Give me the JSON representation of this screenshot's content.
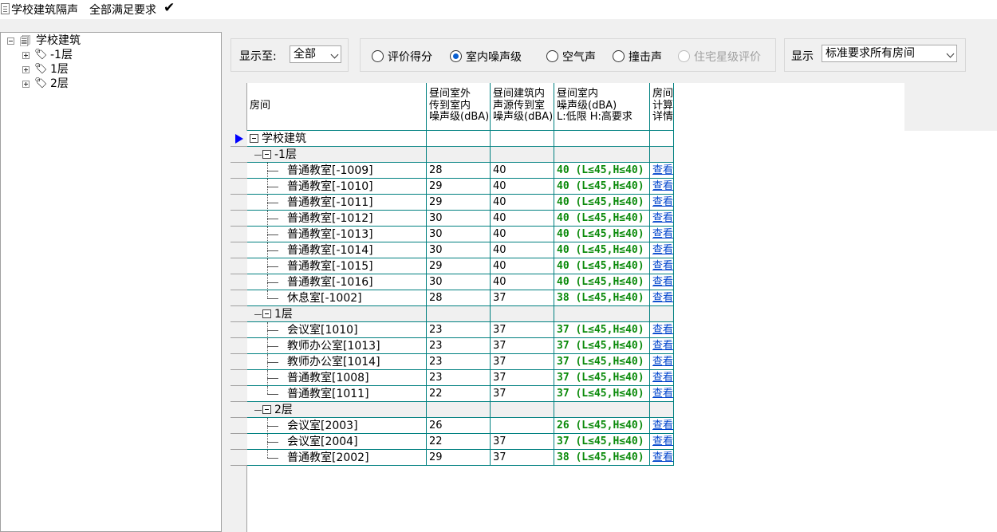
{
  "titlebar": {
    "title": "学校建筑隔声",
    "status": "全部满足要求",
    "check": "✔"
  },
  "tree": {
    "root": "学校建筑",
    "items": [
      "-1层",
      "1层",
      "2层"
    ]
  },
  "toolbar": {
    "show_to_label": "显示至:",
    "show_to_value": "全部",
    "radios": [
      {
        "label": "评价得分",
        "checked": false
      },
      {
        "label": "室内噪声级",
        "checked": true
      },
      {
        "label": "空气声",
        "checked": false
      },
      {
        "label": "撞击声",
        "checked": false
      },
      {
        "label": "住宅星级评价",
        "checked": false,
        "disabled": true
      }
    ],
    "display_label": "显示",
    "display_value": "标准要求所有房间"
  },
  "grid": {
    "headers": [
      "房间",
      "昼间室外\n传到室内\n噪声级(dBA)",
      "昼间建筑内\n声源传到室\n噪声级(dBA)",
      "昼间室内\n噪声级(dBA)\nL:低限 H:高要求",
      "房间\n计算\n详情"
    ],
    "rows": [
      {
        "kind": "root",
        "name": "学校建筑",
        "a": "",
        "b": "",
        "c": "",
        "d": ""
      },
      {
        "kind": "floor",
        "name": "-1层",
        "a": "",
        "b": "",
        "c": "",
        "d": ""
      },
      {
        "kind": "room",
        "name": "普通教室[-1009]",
        "a": "28",
        "b": "40",
        "c": "40 (L≤45,H≤40)",
        "d": "查看"
      },
      {
        "kind": "room",
        "name": "普通教室[-1010]",
        "a": "29",
        "b": "40",
        "c": "40 (L≤45,H≤40)",
        "d": "查看"
      },
      {
        "kind": "room",
        "name": "普通教室[-1011]",
        "a": "29",
        "b": "40",
        "c": "40 (L≤45,H≤40)",
        "d": "查看"
      },
      {
        "kind": "room",
        "name": "普通教室[-1012]",
        "a": "30",
        "b": "40",
        "c": "40 (L≤45,H≤40)",
        "d": "查看"
      },
      {
        "kind": "room",
        "name": "普通教室[-1013]",
        "a": "30",
        "b": "40",
        "c": "40 (L≤45,H≤40)",
        "d": "查看"
      },
      {
        "kind": "room",
        "name": "普通教室[-1014]",
        "a": "30",
        "b": "40",
        "c": "40 (L≤45,H≤40)",
        "d": "查看"
      },
      {
        "kind": "room",
        "name": "普通教室[-1015]",
        "a": "29",
        "b": "40",
        "c": "40 (L≤45,H≤40)",
        "d": "查看"
      },
      {
        "kind": "room",
        "name": "普通教室[-1016]",
        "a": "30",
        "b": "40",
        "c": "40 (L≤45,H≤40)",
        "d": "查看"
      },
      {
        "kind": "room",
        "name": "休息室[-1002]",
        "a": "28",
        "b": "37",
        "c": "38 (L≤45,H≤40)",
        "d": "查看",
        "last": true
      },
      {
        "kind": "floor",
        "name": "1层",
        "a": "",
        "b": "",
        "c": "",
        "d": ""
      },
      {
        "kind": "room",
        "name": "会议室[1010]",
        "a": "23",
        "b": "37",
        "c": "37 (L≤45,H≤40)",
        "d": "查看"
      },
      {
        "kind": "room",
        "name": "教师办公室[1013]",
        "a": "23",
        "b": "37",
        "c": "37 (L≤45,H≤40)",
        "d": "查看"
      },
      {
        "kind": "room",
        "name": "教师办公室[1014]",
        "a": "23",
        "b": "37",
        "c": "37 (L≤45,H≤40)",
        "d": "查看"
      },
      {
        "kind": "room",
        "name": "普通教室[1008]",
        "a": "23",
        "b": "37",
        "c": "37 (L≤45,H≤40)",
        "d": "查看"
      },
      {
        "kind": "room",
        "name": "普通教室[1011]",
        "a": "22",
        "b": "37",
        "c": "37 (L≤45,H≤40)",
        "d": "查看",
        "last": true
      },
      {
        "kind": "floor",
        "name": "2层",
        "a": "",
        "b": "",
        "c": "",
        "d": "",
        "last": true
      },
      {
        "kind": "room",
        "name": "会议室[2003]",
        "a": "26",
        "b": "",
        "c": "26 (L≤45,H≤40)",
        "d": "查看"
      },
      {
        "kind": "room",
        "name": "会议室[2004]",
        "a": "22",
        "b": "37",
        "c": "37 (L≤45,H≤40)",
        "d": "查看"
      },
      {
        "kind": "room",
        "name": "普通教室[2002]",
        "a": "29",
        "b": "37",
        "c": "38 (L≤45,H≤40)",
        "d": "查看",
        "last": true
      }
    ]
  },
  "colors": {
    "ok_green": "#0a8a0a",
    "link_blue": "#0044cc",
    "grid_line": "#008080",
    "selector": "#0000ff"
  }
}
